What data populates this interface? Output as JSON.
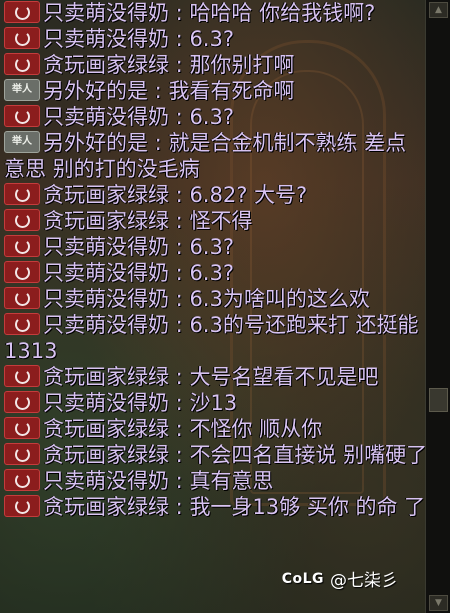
{
  "messages": [
    {
      "badge": "red",
      "speaker": "只卖萌没得奶",
      "text": "哈哈哈 你给我钱啊?"
    },
    {
      "badge": "red",
      "speaker": "只卖萌没得奶",
      "text": "6.3?"
    },
    {
      "badge": "red",
      "speaker": "贪玩画家绿绿",
      "text": "那你别打啊"
    },
    {
      "badge": "gray",
      "badge_text": "举人",
      "speaker": "另外好的是",
      "text": "我看有死命啊"
    },
    {
      "badge": "red",
      "speaker": "只卖萌没得奶",
      "text": "6.3?"
    },
    {
      "badge": "gray",
      "badge_text": "举人",
      "speaker": "另外好的是",
      "text": "就是合金机制不熟练 差点意思 别的打的没毛病"
    },
    {
      "badge": "red",
      "speaker": "贪玩画家绿绿",
      "text": "6.82? 大号?"
    },
    {
      "badge": "red",
      "speaker": "贪玩画家绿绿",
      "text": "怪不得"
    },
    {
      "badge": "red",
      "speaker": "只卖萌没得奶",
      "text": "6.3?"
    },
    {
      "badge": "red",
      "speaker": "只卖萌没得奶",
      "text": "6.3?"
    },
    {
      "badge": "red",
      "speaker": "只卖萌没得奶",
      "text": "6.3为啥叫的这么欢"
    },
    {
      "badge": "red",
      "speaker": "只卖萌没得奶",
      "text": "6.3的号还跑来打 还挺能1313"
    },
    {
      "badge": "red",
      "speaker": "贪玩画家绿绿",
      "text": "大号名望看不见是吧"
    },
    {
      "badge": "red",
      "speaker": "只卖萌没得奶",
      "text": "沙13"
    },
    {
      "badge": "red",
      "speaker": "贪玩画家绿绿",
      "text": "不怪你 顺从你"
    },
    {
      "badge": "red",
      "speaker": "贪玩画家绿绿",
      "text": "不会四名直接说 别嘴硬了"
    },
    {
      "badge": "red",
      "speaker": "只卖萌没得奶",
      "text": "真有意思"
    },
    {
      "badge": "red",
      "speaker": "贪玩画家绿绿",
      "text": "我一身13够 买你 的命 了"
    }
  ],
  "separator": " : ",
  "watermark": {
    "logo": "CoLG",
    "user": "@七柒彡"
  }
}
